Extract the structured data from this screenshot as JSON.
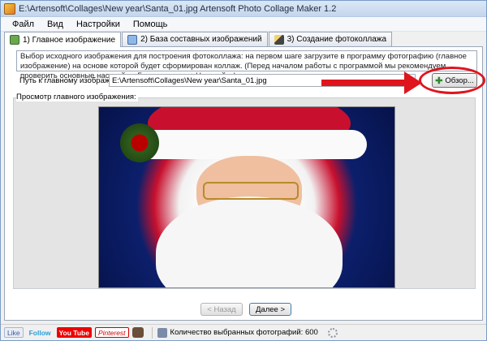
{
  "window": {
    "title": "E:\\Artensoft\\Collages\\New year\\Santa_01.jpg Artensoft Photo Collage Maker 1.2"
  },
  "menu": {
    "items": [
      "Файл",
      "Вид",
      "Настройки",
      "Помощь"
    ]
  },
  "tabs": [
    {
      "label": "1) Главное изображение",
      "icon": "main-image-icon",
      "active": true
    },
    {
      "label": "2) База составных изображений",
      "icon": "database-icon",
      "active": false
    },
    {
      "label": "3) Создание фотоколлажа",
      "icon": "magic-wand-icon",
      "active": false
    }
  ],
  "step1": {
    "description": "Выбор исходного изображения для построения фотоколлажа: на первом шаге загрузите в программу фотографию (главное изображение) на основе которой будет сформирован коллаж. (Перед началом работы с программой мы рекомендуем проверить основные настройки: Главное меню->Настройки)",
    "path_label": "Путь к главному изображению:",
    "path_value": "E:\\Artensoft\\Collages\\New year\\Santa_01.jpg",
    "browse_label": "Обзор...",
    "preview_label": "Просмотр главного изображения:"
  },
  "nav": {
    "back_label": "< Назад",
    "next_label": "Далее >"
  },
  "status": {
    "social": {
      "facebook": "Like",
      "twitter": "Follow",
      "youtube": "You Tube",
      "pinterest": "Pinterest"
    },
    "count_text": "Количество выбранных фотографий: 600"
  },
  "colors": {
    "annotation_red": "#e0141c",
    "title_bar": "#c4d6ed"
  }
}
